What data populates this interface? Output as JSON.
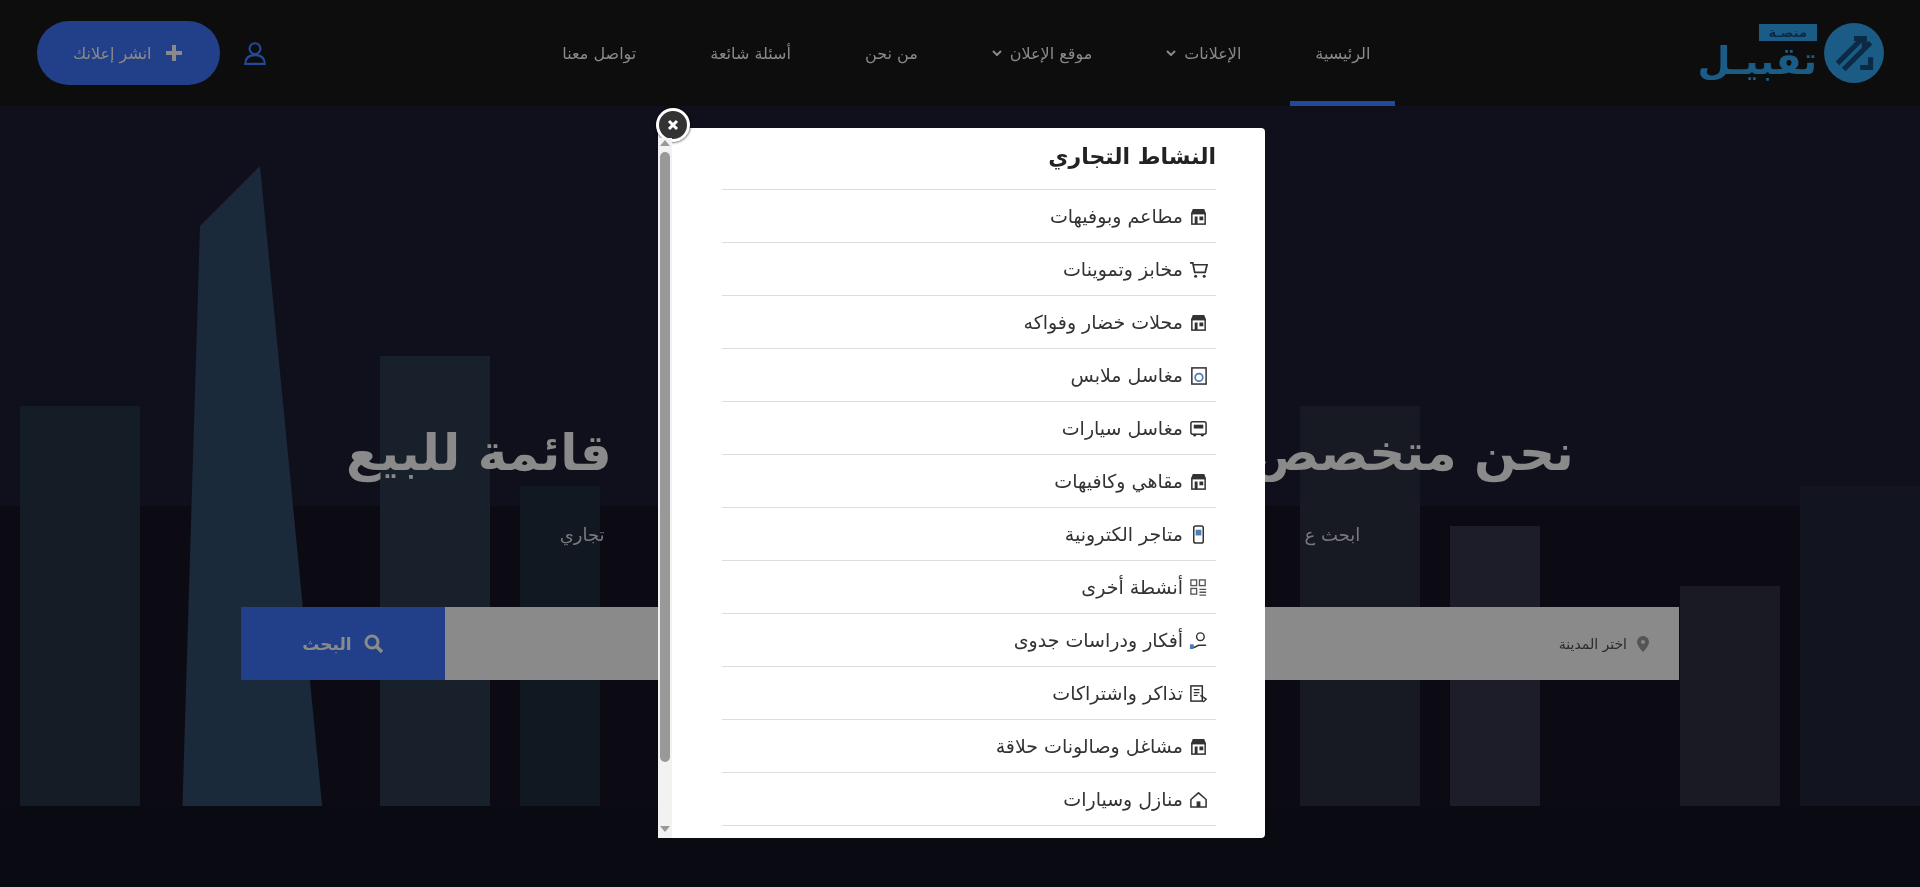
{
  "nav": {
    "logo": {
      "badge": "منصـة",
      "name": "تقبيـل"
    },
    "items": [
      {
        "label": "الرئيسية",
        "selected": true,
        "dropdown": false
      },
      {
        "label": "الإعلانات",
        "selected": false,
        "dropdown": true
      },
      {
        "label": "موقع الإعلان",
        "selected": false,
        "dropdown": true
      },
      {
        "label": "من نحن",
        "selected": false,
        "dropdown": false
      },
      {
        "label": "أسئلة شائعة",
        "selected": false,
        "dropdown": false
      },
      {
        "label": "تواصل معنا",
        "selected": false,
        "dropdown": false
      }
    ],
    "post_button": "انشر إعلانك"
  },
  "hero": {
    "heading_right": "نحن متخصص",
    "heading_left": "قائمة للبيع",
    "subtitle_right": "ابحث ع",
    "subtitle_left": "تجاري",
    "search": {
      "placeholder": "اختر المدينة",
      "button": "البحث"
    }
  },
  "modal": {
    "title": "النشاط التجاري",
    "items": [
      "مطاعم وبوفيهات",
      "مخابز وتموينات",
      "محلات خضار وفواكه",
      "مغاسل ملابس",
      "مغاسل سيارات",
      "مقاهي وكافيهات",
      "متاجر الكترونية",
      "أنشطة أخرى",
      "أفكار ودراسات جدوى",
      "تذاكر واشتراكات",
      "مشاغل وصالونات حلاقة",
      "منازل وسيارات"
    ]
  }
}
